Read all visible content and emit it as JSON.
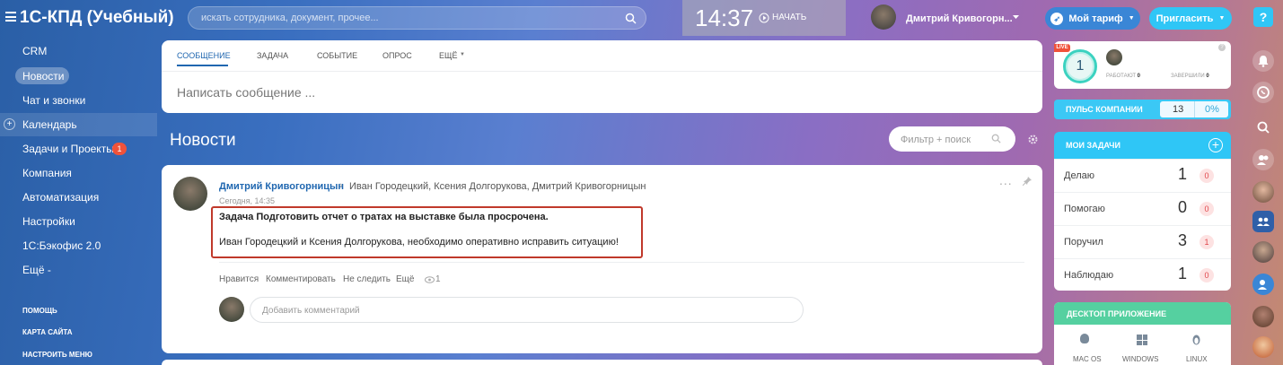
{
  "header": {
    "brand": "1С-КПД (Учебный)",
    "search_placeholder": "искать сотрудника, документ, прочее...",
    "clock_time": "14:37",
    "clock_start": "НАЧАТЬ",
    "user_name": "Дмитрий Кривогорн...",
    "tariff_label": "Мой тариф",
    "invite_label": "Пригласить",
    "help_label": "?"
  },
  "sidebar": {
    "items": [
      {
        "label": "CRM"
      },
      {
        "label": "Новости"
      },
      {
        "label": "Чат и звонки"
      },
      {
        "label": "Календарь"
      },
      {
        "label": "Задачи и Проекты",
        "badge": "1"
      },
      {
        "label": "Компания"
      },
      {
        "label": "Автоматизация"
      },
      {
        "label": "Настройки"
      },
      {
        "label": "1С:Бэкофис 2.0"
      },
      {
        "label": "Ещё -"
      }
    ],
    "footer": [
      "ПОМОЩЬ",
      "КАРТА САЙТА",
      "НАСТРОИТЬ МЕНЮ"
    ]
  },
  "composer": {
    "tabs": [
      "СООБЩЕНИЕ",
      "ЗАДАЧА",
      "СОБЫТИЕ",
      "ОПРОС",
      "ЕЩЁ"
    ],
    "placeholder": "Написать сообщение ..."
  },
  "feed": {
    "title": "Новости",
    "filter_placeholder": "Фильтр + поиск"
  },
  "post": {
    "author": "Дмитрий Кривогорницын",
    "recipients": "Иван Городецкий, Ксения Долгорукова, Дмитрий Кривогорницын",
    "time": "Сегодня, 14:35",
    "line1": "Задача Подготовить отчет о тратах на выставке была просрочена.",
    "line2": "Иван Городецкий и Ксения Долгорукова, необходимо оперативно исправить ситуацию!",
    "actions": [
      "Нравится",
      "Комментировать",
      "Не следить",
      "Ещё"
    ],
    "views": "1",
    "comment_placeholder": "Добавить комментарий",
    "more": "..."
  },
  "timeman": {
    "live": "LIVE",
    "count": "1",
    "working_label": "РАБОТАЮТ",
    "working_value": "0",
    "finished_label": "ЗАВЕРШИЛИ",
    "finished_value": "0"
  },
  "pulse": {
    "label": "ПУЛЬС КОМПАНИИ",
    "value": "13",
    "percent": "0%"
  },
  "tasks": {
    "title": "МОИ ЗАДАЧИ",
    "rows": [
      {
        "label": "Делаю",
        "count": "1",
        "badge": "0"
      },
      {
        "label": "Помогаю",
        "count": "0",
        "badge": "0"
      },
      {
        "label": "Поручил",
        "count": "3",
        "badge": "1"
      },
      {
        "label": "Наблюдаю",
        "count": "1",
        "badge": "0"
      }
    ]
  },
  "desktop": {
    "title": "ДЕСКТОП ПРИЛОЖЕНИЕ",
    "os": [
      "MAC OS",
      "WINDOWS",
      "LINUX"
    ]
  },
  "colors": {
    "accent": "#2fc6f6",
    "pulse_bg": "#3bc8f5",
    "task_header": "#2fc6f6",
    "desktop_header": "#55d0a0",
    "alert_border": "#c0392b",
    "badge_red": "#f0523a"
  }
}
